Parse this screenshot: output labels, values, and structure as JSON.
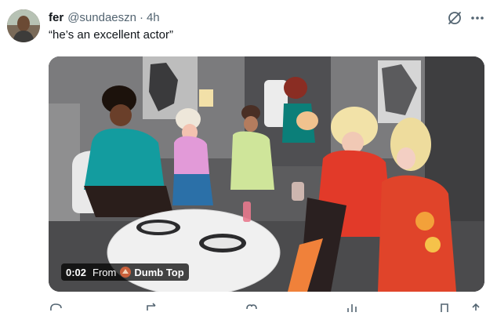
{
  "tweet": {
    "display_name": "fer",
    "handle": "@sundaeszn",
    "separator": "·",
    "time": "4h",
    "text": "“he’s an excellent actor”"
  },
  "icons": {
    "grok": "grok-slash-circle-icon",
    "more": "more-horizontal-icon",
    "source": "dumb-top-avatar-icon"
  },
  "media": {
    "duration": "0:02",
    "from_label": "From",
    "source_name": "Dumb Top"
  },
  "colors": {
    "text_primary": "#0f1419",
    "text_secondary": "#536471",
    "overlay_bg": "#000000b8",
    "action_icon": "#536471"
  }
}
